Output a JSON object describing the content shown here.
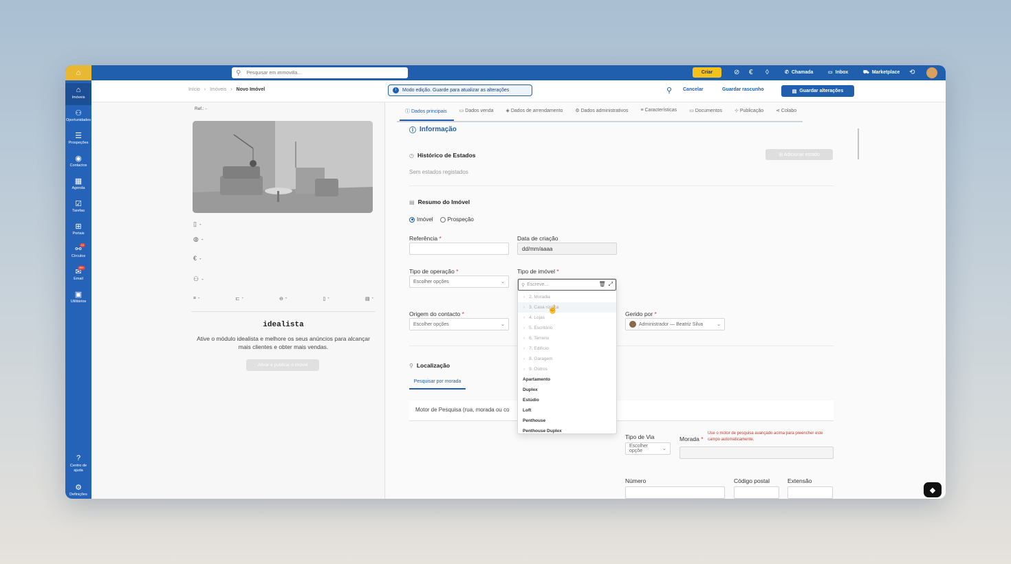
{
  "topbar": {
    "search_placeholder": "Pesquisar em immovilla...",
    "create_label": "Criar",
    "links": [
      {
        "label": "Chamada",
        "icon": "phone-icon"
      },
      {
        "label": "Inbox",
        "icon": "chat-icon"
      },
      {
        "label": "Marketplace",
        "icon": "cart-icon"
      }
    ]
  },
  "sidebar": {
    "items": [
      {
        "label": "Imóveis",
        "icon": "home-icon"
      },
      {
        "label": "Oportunidades",
        "icon": "users-icon"
      },
      {
        "label": "Prospeções",
        "icon": "list-icon"
      },
      {
        "label": "Contactos",
        "icon": "contact-icon"
      },
      {
        "label": "Agenda",
        "icon": "calendar-icon"
      },
      {
        "label": "Tarefas",
        "icon": "clipboard-icon"
      },
      {
        "label": "Portais",
        "icon": "portal-icon"
      },
      {
        "label": "Círculos",
        "icon": "circles-icon",
        "badge": "12"
      },
      {
        "label": "Email",
        "icon": "email-icon",
        "badge": "99+"
      },
      {
        "label": "Utilitários",
        "icon": "tools-icon"
      }
    ],
    "help_label": "Centro de ajuda",
    "settings_label": "Definições"
  },
  "subheader": {
    "breadcrumb": [
      "Início",
      "Imóveis",
      "Novo Imóvel"
    ],
    "mode_text": "Modo edição. Guarde para atualizar as alterações",
    "cancel": "Cancelar",
    "draft": "Guardar rascunho",
    "save": "Guardar alterações"
  },
  "left": {
    "ref": "Ref.: -",
    "meta": [
      "-",
      "-",
      "-",
      "-"
    ],
    "features": [
      "-",
      "-",
      "-",
      "-",
      "-"
    ],
    "idealista_logo": "idealista",
    "idealista_text": "Ative o módulo idealista e melhore os seus anúncios para alcançar mais clientes e obter mais vendas.",
    "idealista_button": "Ativar e publicar o imóvel"
  },
  "tabs": [
    {
      "label": "Dados principais",
      "active": true
    },
    {
      "label": "Dados venda"
    },
    {
      "label": "Dados de arrendamento"
    },
    {
      "label": "Dados administrativos"
    },
    {
      "label": "Características"
    },
    {
      "label": "Documentos"
    },
    {
      "label": "Publicação"
    },
    {
      "label": "Colabo"
    }
  ],
  "form": {
    "section_info": "Informação",
    "historico_title": "Histórico de Estados",
    "historico_empty": "Sem estados registados",
    "add_estado": "Adicionar estado",
    "resumo_title": "Resumo do Imóvel",
    "radio_imovel": "Imóvel",
    "radio_prospecao": "Prospeção",
    "referencia_label": "Referência",
    "data_label": "Data de criação",
    "data_value": "dd/mm/aaaa",
    "tipo_operacao_label": "Tipo de operação",
    "tipo_imovel_label": "Tipo de imóvel",
    "select_placeholder": "Escolher opções",
    "origem_label": "Origem do contacto",
    "gerido_label": "Gerido por",
    "gerido_value": "Administrador — Beatriz Silva",
    "localizacao_title": "Localização",
    "search_tab": "Pesquisar por morada",
    "motor_text": "Motor de Pesquisa (rua, morada ou co",
    "tipo_via_label": "Tipo de Via",
    "tipo_via_placeholder": "Escolher opçõe",
    "morada_label": "Morada",
    "morada_warning": "Use o motor de pesquisa avançado acima para preencher este campo automaticamente.",
    "numero_label": "Número",
    "codigo_postal_label": "Código postal",
    "extensao_label": "Extensão"
  },
  "dropdown": {
    "search_placeholder": "Escreve...",
    "groups": [
      "2. Moradia",
      "3. Casa rústica",
      "4. Lojas",
      "5. Escritório",
      "6. Terreno",
      "7. Edifício",
      "8. Garagem",
      "9. Outros"
    ],
    "leaves": [
      "Apartamento",
      "Duplex",
      "Estúdio",
      "Loft",
      "Penthouse",
      "Penthouse Duplex"
    ],
    "hover_index": 1
  },
  "colors": {
    "primary": "#1f5fae",
    "sidebar": "#2563b9",
    "accent_yellow": "#f4c21b",
    "required": "#d23b3b"
  }
}
